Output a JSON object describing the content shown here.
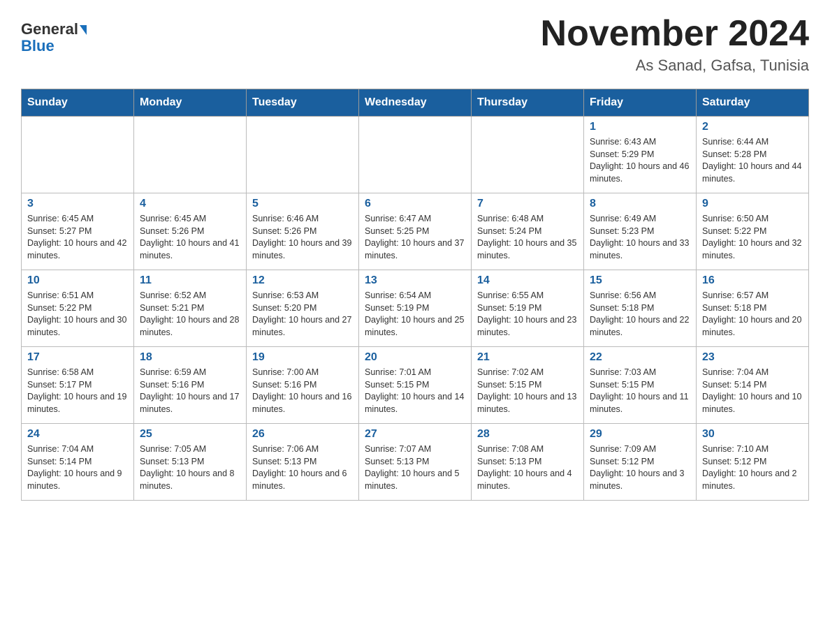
{
  "header": {
    "logo_line1": "General",
    "logo_line2": "Blue",
    "month_title": "November 2024",
    "location": "As Sanad, Gafsa, Tunisia"
  },
  "days_of_week": [
    "Sunday",
    "Monday",
    "Tuesday",
    "Wednesday",
    "Thursday",
    "Friday",
    "Saturday"
  ],
  "weeks": [
    [
      {
        "day": "",
        "info": ""
      },
      {
        "day": "",
        "info": ""
      },
      {
        "day": "",
        "info": ""
      },
      {
        "day": "",
        "info": ""
      },
      {
        "day": "",
        "info": ""
      },
      {
        "day": "1",
        "info": "Sunrise: 6:43 AM\nSunset: 5:29 PM\nDaylight: 10 hours and 46 minutes."
      },
      {
        "day": "2",
        "info": "Sunrise: 6:44 AM\nSunset: 5:28 PM\nDaylight: 10 hours and 44 minutes."
      }
    ],
    [
      {
        "day": "3",
        "info": "Sunrise: 6:45 AM\nSunset: 5:27 PM\nDaylight: 10 hours and 42 minutes."
      },
      {
        "day": "4",
        "info": "Sunrise: 6:45 AM\nSunset: 5:26 PM\nDaylight: 10 hours and 41 minutes."
      },
      {
        "day": "5",
        "info": "Sunrise: 6:46 AM\nSunset: 5:26 PM\nDaylight: 10 hours and 39 minutes."
      },
      {
        "day": "6",
        "info": "Sunrise: 6:47 AM\nSunset: 5:25 PM\nDaylight: 10 hours and 37 minutes."
      },
      {
        "day": "7",
        "info": "Sunrise: 6:48 AM\nSunset: 5:24 PM\nDaylight: 10 hours and 35 minutes."
      },
      {
        "day": "8",
        "info": "Sunrise: 6:49 AM\nSunset: 5:23 PM\nDaylight: 10 hours and 33 minutes."
      },
      {
        "day": "9",
        "info": "Sunrise: 6:50 AM\nSunset: 5:22 PM\nDaylight: 10 hours and 32 minutes."
      }
    ],
    [
      {
        "day": "10",
        "info": "Sunrise: 6:51 AM\nSunset: 5:22 PM\nDaylight: 10 hours and 30 minutes."
      },
      {
        "day": "11",
        "info": "Sunrise: 6:52 AM\nSunset: 5:21 PM\nDaylight: 10 hours and 28 minutes."
      },
      {
        "day": "12",
        "info": "Sunrise: 6:53 AM\nSunset: 5:20 PM\nDaylight: 10 hours and 27 minutes."
      },
      {
        "day": "13",
        "info": "Sunrise: 6:54 AM\nSunset: 5:19 PM\nDaylight: 10 hours and 25 minutes."
      },
      {
        "day": "14",
        "info": "Sunrise: 6:55 AM\nSunset: 5:19 PM\nDaylight: 10 hours and 23 minutes."
      },
      {
        "day": "15",
        "info": "Sunrise: 6:56 AM\nSunset: 5:18 PM\nDaylight: 10 hours and 22 minutes."
      },
      {
        "day": "16",
        "info": "Sunrise: 6:57 AM\nSunset: 5:18 PM\nDaylight: 10 hours and 20 minutes."
      }
    ],
    [
      {
        "day": "17",
        "info": "Sunrise: 6:58 AM\nSunset: 5:17 PM\nDaylight: 10 hours and 19 minutes."
      },
      {
        "day": "18",
        "info": "Sunrise: 6:59 AM\nSunset: 5:16 PM\nDaylight: 10 hours and 17 minutes."
      },
      {
        "day": "19",
        "info": "Sunrise: 7:00 AM\nSunset: 5:16 PM\nDaylight: 10 hours and 16 minutes."
      },
      {
        "day": "20",
        "info": "Sunrise: 7:01 AM\nSunset: 5:15 PM\nDaylight: 10 hours and 14 minutes."
      },
      {
        "day": "21",
        "info": "Sunrise: 7:02 AM\nSunset: 5:15 PM\nDaylight: 10 hours and 13 minutes."
      },
      {
        "day": "22",
        "info": "Sunrise: 7:03 AM\nSunset: 5:15 PM\nDaylight: 10 hours and 11 minutes."
      },
      {
        "day": "23",
        "info": "Sunrise: 7:04 AM\nSunset: 5:14 PM\nDaylight: 10 hours and 10 minutes."
      }
    ],
    [
      {
        "day": "24",
        "info": "Sunrise: 7:04 AM\nSunset: 5:14 PM\nDaylight: 10 hours and 9 minutes."
      },
      {
        "day": "25",
        "info": "Sunrise: 7:05 AM\nSunset: 5:13 PM\nDaylight: 10 hours and 8 minutes."
      },
      {
        "day": "26",
        "info": "Sunrise: 7:06 AM\nSunset: 5:13 PM\nDaylight: 10 hours and 6 minutes."
      },
      {
        "day": "27",
        "info": "Sunrise: 7:07 AM\nSunset: 5:13 PM\nDaylight: 10 hours and 5 minutes."
      },
      {
        "day": "28",
        "info": "Sunrise: 7:08 AM\nSunset: 5:13 PM\nDaylight: 10 hours and 4 minutes."
      },
      {
        "day": "29",
        "info": "Sunrise: 7:09 AM\nSunset: 5:12 PM\nDaylight: 10 hours and 3 minutes."
      },
      {
        "day": "30",
        "info": "Sunrise: 7:10 AM\nSunset: 5:12 PM\nDaylight: 10 hours and 2 minutes."
      }
    ]
  ]
}
